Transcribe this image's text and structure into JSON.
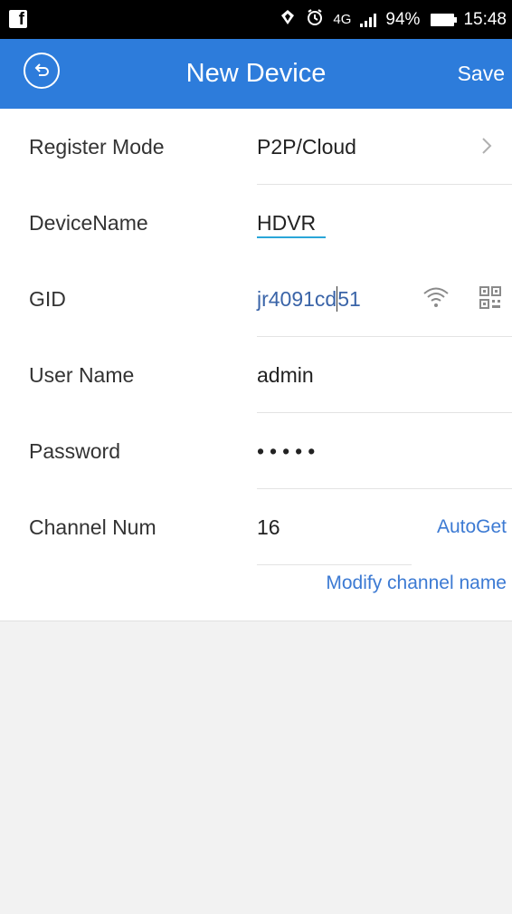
{
  "status_bar": {
    "app_icon": "f",
    "battery": "94%",
    "time": "15:48",
    "network": "4G"
  },
  "header": {
    "title": "New Device",
    "save_label": "Save",
    "back_icon": "back-circle-icon"
  },
  "form": {
    "register_mode": {
      "label": "Register Mode",
      "value": "P2P/Cloud"
    },
    "device_name": {
      "label": "DeviceName",
      "value": "HDVR"
    },
    "gid": {
      "label": "GID",
      "value_before_cursor": "jr4091cd",
      "value_after_cursor": "51"
    },
    "user_name": {
      "label": "User Name",
      "value": "admin"
    },
    "password": {
      "label": "Password",
      "value": "•••••"
    },
    "channel_num": {
      "label": "Channel Num",
      "value": "16",
      "autoget_label": "AutoGet"
    },
    "modify_channel_label": "Modify channel name"
  },
  "colors": {
    "header_bg": "#2d7cdb",
    "link": "#3c7ad3",
    "gid_text": "#3a64a8",
    "underline": "#2aa6d8"
  }
}
